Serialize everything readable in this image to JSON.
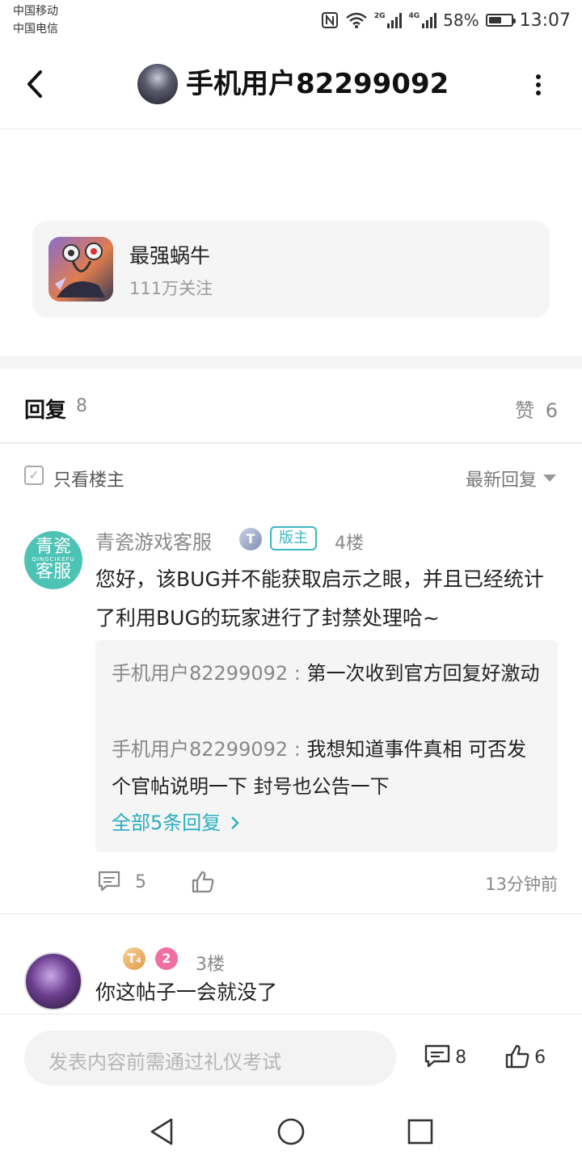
{
  "status_bar": {
    "carrier_1": "中国移动",
    "carrier_2": "中国电信",
    "sim1_tech": "2G",
    "sim2_tech": "4G",
    "battery": "58%",
    "battery_level": 0.58,
    "time": "13:07"
  },
  "header": {
    "title": "手机用户82299092"
  },
  "forum": {
    "name": "最强蜗牛",
    "followers": "111万关注"
  },
  "tabs": {
    "replies_label": "回复",
    "replies_count": "8",
    "likes_label": "赞",
    "likes_count": "6"
  },
  "filter": {
    "only_op_label": "只看楼主",
    "sort_label": "最新回复"
  },
  "comments": [
    {
      "avatar_line1": "青瓷",
      "avatar_sub": "QINGCIKEFU",
      "avatar_line2": "客服",
      "username": "青瓷游戏客服",
      "badge_level": "T",
      "badge_role": "版主",
      "floor": "4楼",
      "text": "您好，该BUG并不能获取启示之眼，并且已经统计了利用BUG的玩家进行了封禁处理哈~",
      "sub_replies": [
        {
          "user": "手机用户82299092",
          "text": "第一次收到官方回复好激动"
        },
        {
          "user": "手机用户82299092",
          "text": "我想知道事件真相 可否发个官帖说明一下  封号也公告一下"
        }
      ],
      "more_replies": "全部5条回复",
      "reply_count": "5",
      "time": "13分钟前"
    },
    {
      "badge_level": "T",
      "badge_level_sub": "4",
      "badge_num": "2",
      "floor": "3楼",
      "text": "你这帖子一会就没了"
    }
  ],
  "bottom_bar": {
    "input_placeholder": "发表内容前需通过礼仪考试",
    "comment_count": "8",
    "like_count": "6"
  },
  "icons": [
    "back-arrow-icon",
    "more-vertical-icon",
    "nfc-icon",
    "wifi-icon",
    "comment-icon",
    "thumbs-up-icon",
    "chevron-right-icon",
    "caret-down-icon",
    "checkbox-icon"
  ],
  "colors": {
    "accent_teal": "#3bb6c5",
    "link_blue": "#2aaebf",
    "cs_avatar": "#4cc3b5",
    "muted_text": "#888888"
  }
}
